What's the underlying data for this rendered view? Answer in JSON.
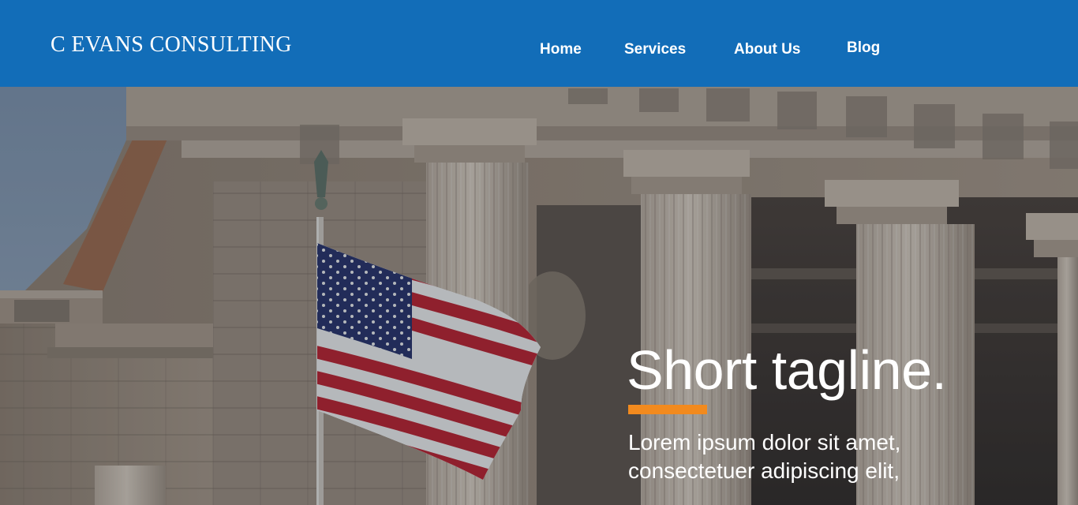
{
  "header": {
    "brand": "C EVANS CONSULTING",
    "nav": [
      {
        "label": "Home"
      },
      {
        "label": "Services"
      },
      {
        "label": "About Us"
      },
      {
        "label": "Blog"
      }
    ]
  },
  "hero": {
    "background_image": "us-flag-government-building-columns",
    "tagline": "Short tagline.",
    "lead_line_1": "Lorem ipsum dolor sit amet,",
    "lead_line_2": "consectetuer adipiscing elit,"
  },
  "colors": {
    "header_bg": "#126db8",
    "accent": "#f28a1e",
    "text": "#ffffff"
  }
}
